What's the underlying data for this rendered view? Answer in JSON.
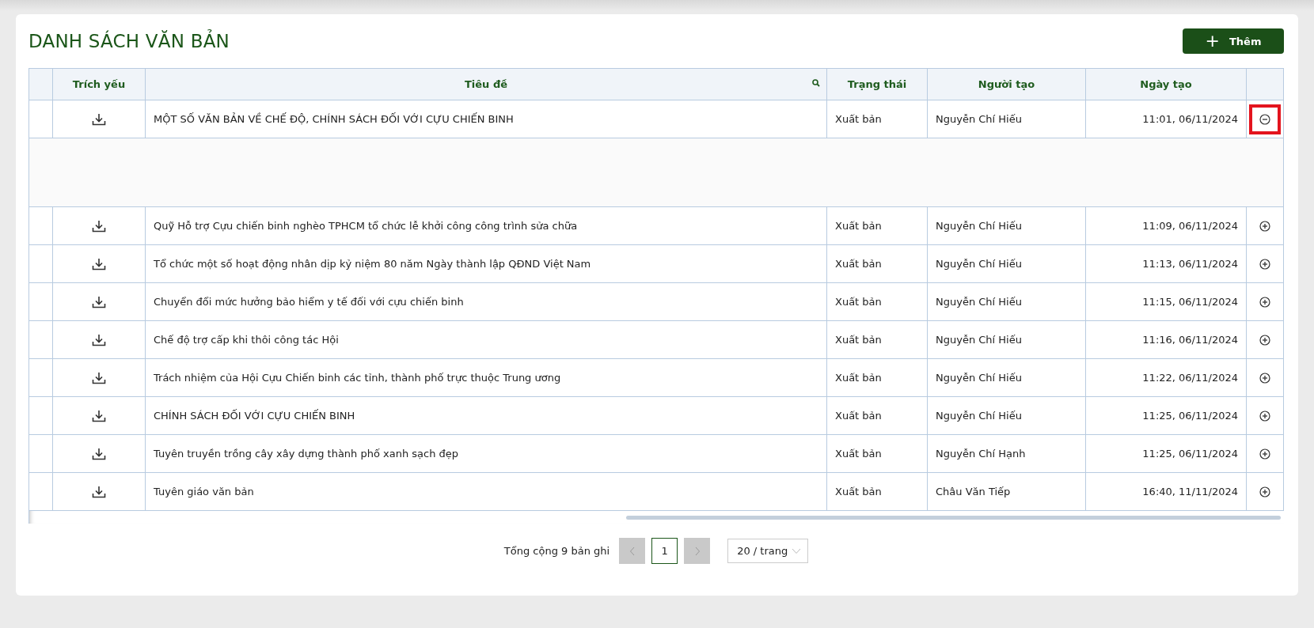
{
  "title": "DANH SÁCH VĂN BẢN",
  "add_button": {
    "icon": "+",
    "label": "Thêm"
  },
  "table": {
    "columns": [
      "Trích yếu",
      "Tiêu đề",
      "Trạng thái",
      "Người tạo",
      "Ngày tạo"
    ],
    "rows": [
      {
        "title": "MỘT SỐ VĂN BẢN VỀ CHẾ ĐỘ, CHÍNH SÁCH ĐỐI VỚI CỰU CHIẾN BINH",
        "status": "Xuất bản",
        "creator": "Nguyễn Chí Hiếu",
        "created": "11:01, 06/11/2024",
        "expanded": true,
        "highlighted": true
      },
      {
        "title": "Quỹ Hỗ trợ Cựu chiến binh nghèo TPHCM tổ chức lễ khởi công công trình sửa chữa",
        "status": "Xuất bản",
        "creator": "Nguyễn Chí Hiếu",
        "created": "11:09, 06/11/2024",
        "expanded": false,
        "highlighted": false
      },
      {
        "title": "Tổ chức một số hoạt động nhân dịp kỷ niệm 80 năm Ngày thành lập QĐND Việt Nam",
        "status": "Xuất bản",
        "creator": "Nguyễn Chí Hiếu",
        "created": "11:13, 06/11/2024",
        "expanded": false,
        "highlighted": false
      },
      {
        "title": "Chuyển đổi mức hưởng bảo hiểm y tế đối với cựu chiến binh",
        "status": "Xuất bản",
        "creator": "Nguyễn Chí Hiếu",
        "created": "11:15, 06/11/2024",
        "expanded": false,
        "highlighted": false
      },
      {
        "title": "Chế độ trợ cấp khi thôi công tác Hội",
        "status": "Xuất bản",
        "creator": "Nguyễn Chí Hiếu",
        "created": "11:16, 06/11/2024",
        "expanded": false,
        "highlighted": false
      },
      {
        "title": "Trách nhiệm của Hội Cựu Chiến binh các tỉnh, thành phố trực thuộc Trung ương",
        "status": "Xuất bản",
        "creator": "Nguyễn Chí Hiếu",
        "created": "11:22, 06/11/2024",
        "expanded": false,
        "highlighted": false
      },
      {
        "title": "CHÍNH SÁCH ĐỐI VỚI CỰU CHIẾN BINH",
        "status": "Xuất bản",
        "creator": "Nguyễn Chí Hiếu",
        "created": "11:25, 06/11/2024",
        "expanded": false,
        "highlighted": false
      },
      {
        "title": "Tuyên truyền trồng cây xây dựng thành phố xanh sạch đẹp",
        "status": "Xuất bản",
        "creator": "Nguyễn Chí Hạnh",
        "created": "11:25, 06/11/2024",
        "expanded": false,
        "highlighted": false
      },
      {
        "title": "Tuyên giáo văn bản",
        "status": "Xuất bản",
        "creator": "Châu Văn Tiếp",
        "created": "16:40, 11/11/2024",
        "expanded": false,
        "highlighted": false
      }
    ]
  },
  "pagination": {
    "total": "Tổng cộng 9 bản ghi",
    "prev_disabled": true,
    "pages": [
      {
        "label": "1",
        "selected": true
      }
    ],
    "next_disabled": true,
    "page_size": "20 / trang"
  }
}
